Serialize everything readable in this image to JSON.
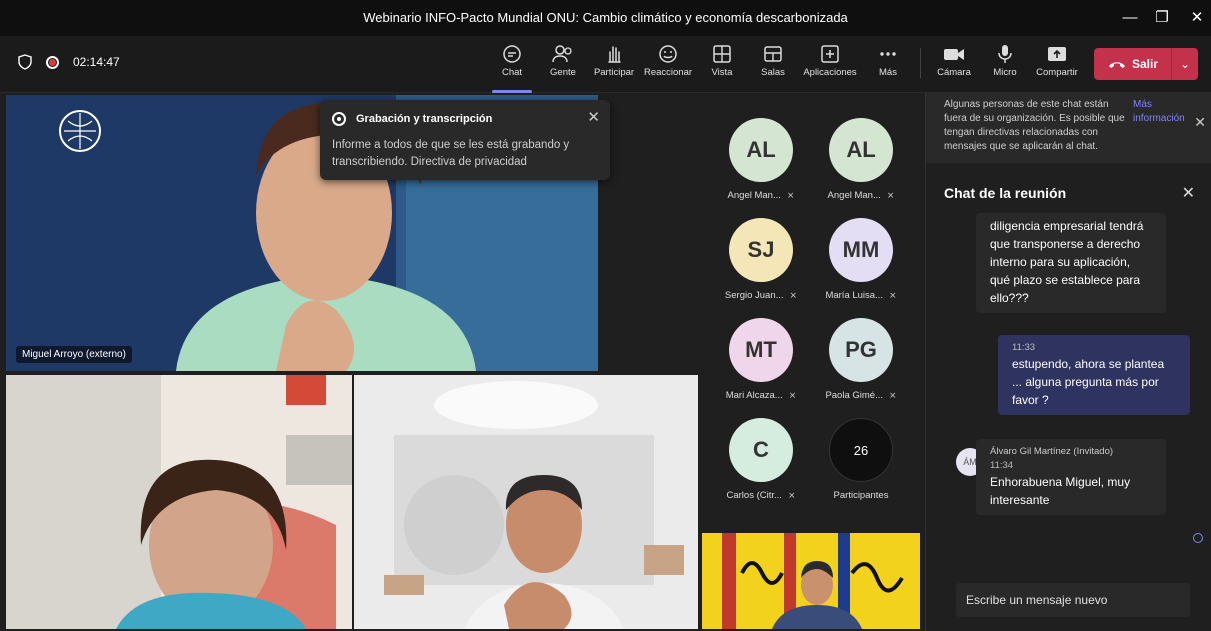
{
  "window": {
    "title": "Webinario INFO-Pacto Mundial ONU: Cambio climático y economía descarbonizada"
  },
  "toolbar": {
    "timer": "02:14:47",
    "buttons": [
      {
        "label": "Chat",
        "icon": "chat-icon"
      },
      {
        "label": "Gente",
        "icon": "people-icon"
      },
      {
        "label": "Participar",
        "icon": "raise-hand-icon"
      },
      {
        "label": "Reaccionar",
        "icon": "smile-icon"
      },
      {
        "label": "Vista",
        "icon": "grid-icon"
      },
      {
        "label": "Salas",
        "icon": "rooms-icon"
      },
      {
        "label": "Aplicaciones",
        "icon": "apps-icon"
      },
      {
        "label": "Más",
        "icon": "more-icon"
      },
      {
        "label": "Cámara",
        "icon": "camera-icon"
      },
      {
        "label": "Micro",
        "icon": "microphone-icon"
      },
      {
        "label": "Compartir",
        "icon": "share-icon"
      }
    ],
    "leave_label": "Salir"
  },
  "recording_popup": {
    "title": "Grabación y transcripción",
    "body": "Informe a todos de que se les está grabando y transcribiendo. Directiva de privacidad"
  },
  "video_tiles": {
    "main_name": "Miguel Arroyo (externo)"
  },
  "participants": [
    {
      "initials": "AL",
      "name": "Angel Man...",
      "color": "#d4e6d2"
    },
    {
      "initials": "AL",
      "name": "Angel Man...",
      "color": "#d4e6d2"
    },
    {
      "initials": "SJ",
      "name": "Sergio Juan...",
      "color": "#f5e6b8"
    },
    {
      "initials": "MM",
      "name": "María Luisa...",
      "color": "#e3def3"
    },
    {
      "initials": "MT",
      "name": "Mari Alcaza...",
      "color": "#f0d6ea"
    },
    {
      "initials": "PG",
      "name": "Paola Gimé...",
      "color": "#d6e4e6"
    },
    {
      "initials": "C",
      "name": "Carlos (Citr...",
      "color": "#d4eddf"
    },
    {
      "initials": "26",
      "name": "Participantes",
      "color": "#0f0f0f"
    }
  ],
  "chat": {
    "notice": "Algunas personas de este chat están fuera de su organización. Es posible que tengan directivas relacionadas con mensajes que se aplicarán al chat.",
    "notice_link": "Más información",
    "header": "Chat de la reunión",
    "messages": [
      {
        "text": "diligencia empresarial tendrá que transponerse a derecho interno para su aplicación, qué plazo se establece para ello???"
      },
      {
        "time": "11:33",
        "text": "estupendo, ahora se plantea ... alguna pregunta más por favor ?"
      },
      {
        "author": "Álvaro Gil Martínez (Invitado)",
        "time": "11:34",
        "text": "Enhorabuena Miguel, muy interesante",
        "avatar": "ÁM"
      }
    ],
    "compose_placeholder": "Escribe un mensaje nuevo"
  }
}
